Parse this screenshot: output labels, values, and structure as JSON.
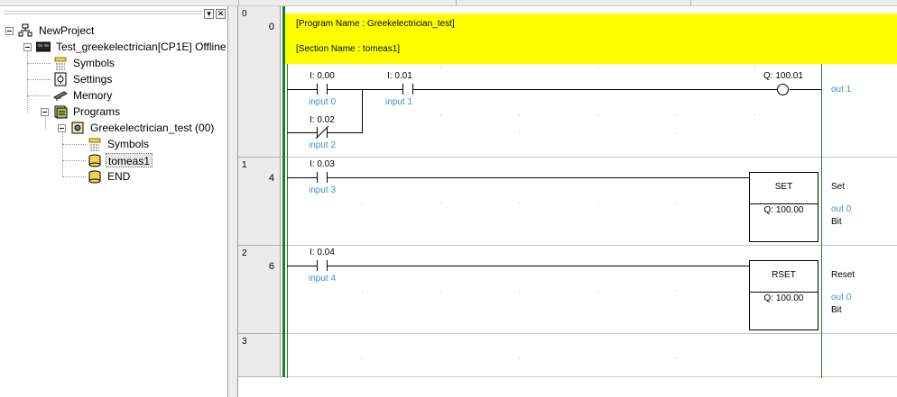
{
  "tree": {
    "root": "NewProject",
    "plc": "Test_greekelectrician[CP1E] Offline",
    "symbols": "Symbols",
    "settings": "Settings",
    "memory": "Memory",
    "programs": "Programs",
    "program": "Greekelectrician_test (00)",
    "prog_symbols": "Symbols",
    "section": "tomeas1",
    "end": "END"
  },
  "pane_buttons": {
    "pin": "▾",
    "close": "✕"
  },
  "ladder": {
    "comment": {
      "program_name": "[Program Name : Greekelectrician_test]",
      "section_name": "[Section Name : tomeas1]"
    },
    "rungs": [
      {
        "index": "0",
        "step": "0",
        "contacts": [
          {
            "address": "I: 0.00",
            "symbol": "input 0"
          },
          {
            "address": "I: 0.01",
            "symbol": "input 1"
          },
          {
            "address": "I: 0.02",
            "symbol": "input 2"
          }
        ],
        "output": {
          "address": "Q: 100.01",
          "symbol": "out 1"
        }
      },
      {
        "index": "1",
        "step": "4",
        "contact": {
          "address": "I: 0.03",
          "symbol": "input 3"
        },
        "instruction": {
          "name": "SET",
          "operand": "Q: 100.00"
        },
        "right_comment": {
          "title": "Set",
          "symbol": "out 0",
          "type": "Bit"
        }
      },
      {
        "index": "2",
        "step": "6",
        "contact": {
          "address": "I: 0.04",
          "symbol": "input 4"
        },
        "instruction": {
          "name": "RSET",
          "operand": "Q: 100.00"
        },
        "right_comment": {
          "title": "Reset",
          "symbol": "out 0",
          "type": "Bit"
        }
      },
      {
        "index": "3"
      }
    ]
  },
  "colors": {
    "comment_bg": "#ffff00",
    "rail": "#1c7a2c",
    "symbol_text": "#3d8fd1",
    "gutter": "#ebebeb"
  }
}
